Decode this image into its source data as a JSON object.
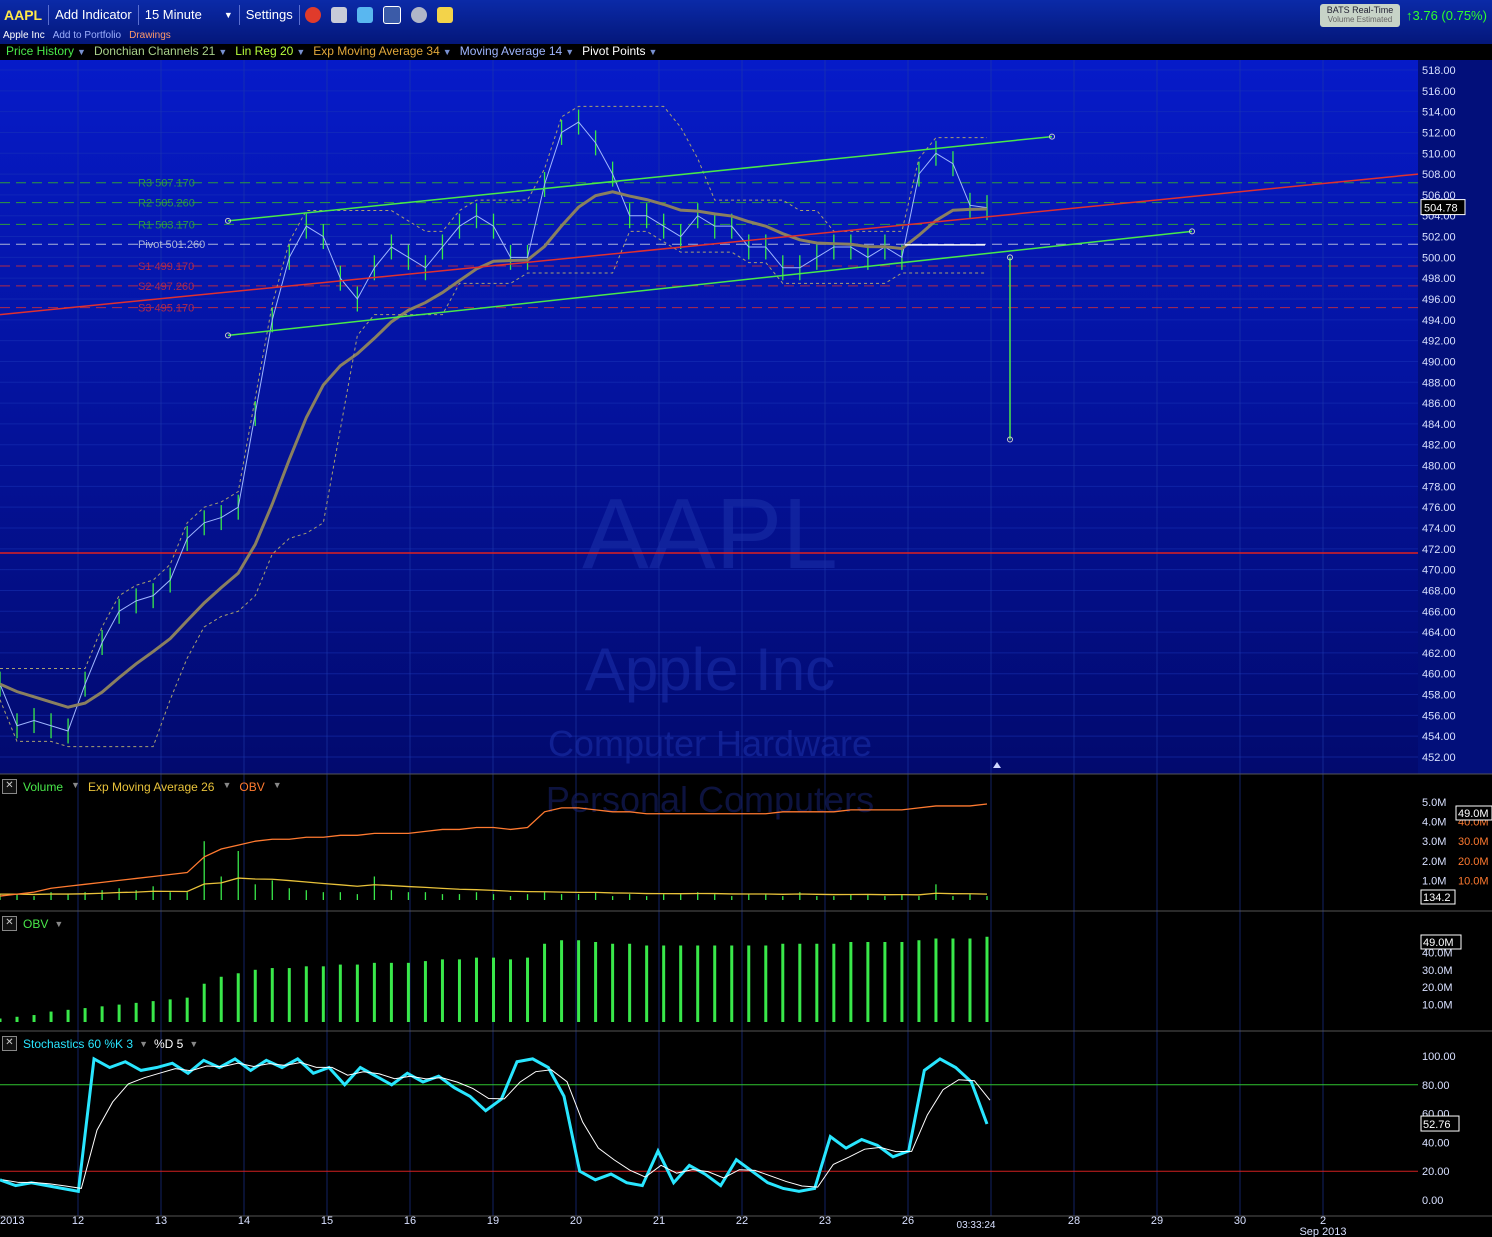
{
  "toolbar": {
    "symbol": "AAPL",
    "add_indicator": "Add Indicator",
    "interval": "15 Minute",
    "settings": "Settings",
    "company_name": "Apple Inc",
    "add_to_portfolio": "Add to Portfolio",
    "drawings": "Drawings",
    "realtime_title": "BATS Real-Time",
    "realtime_sub": "Volume Estimated",
    "change": "3.76 (0.75%)"
  },
  "indicators": [
    {
      "label": "Price History",
      "color": "#49e84a"
    },
    {
      "label": "Donchian Channels 21",
      "color": "#a8d08a"
    },
    {
      "label": "Lin Reg 20",
      "color": "#b7ff3c"
    },
    {
      "label": "Exp Moving Average 34",
      "color": "#e0a73a"
    },
    {
      "label": "Moving Average 14",
      "color": "#9fb6ff"
    },
    {
      "label": "Pivot Points",
      "color": "#ffffff"
    }
  ],
  "watermark": {
    "symbol": "AAPL",
    "company": "Apple Inc",
    "sector": "Computer Hardware",
    "industry": "Personal Computers"
  },
  "pivots": [
    {
      "label": "R3 507.170",
      "value": 507.17,
      "color": "#2f9b3e"
    },
    {
      "label": "R2 505.260",
      "value": 505.26,
      "color": "#2f9b3e"
    },
    {
      "label": "R1 503.170",
      "value": 503.17,
      "color": "#2f9b3e"
    },
    {
      "label": "Pivot 501.260",
      "value": 501.26,
      "color": "#aab4d8"
    },
    {
      "label": "S1 499.170",
      "value": 499.17,
      "color": "#b02a4a"
    },
    {
      "label": "S2 497.260",
      "value": 497.26,
      "color": "#b02a4a"
    },
    {
      "label": "S3 495.170",
      "value": 495.17,
      "color": "#b02a4a"
    }
  ],
  "price_ticks": [
    "518.00",
    "516.00",
    "514.00",
    "512.00",
    "510.00",
    "508.00",
    "506.00",
    "504.00",
    "502.00",
    "500.00",
    "498.00",
    "496.00",
    "494.00",
    "492.00",
    "490.00",
    "488.00",
    "486.00",
    "484.00",
    "482.00",
    "480.00",
    "478.00",
    "476.00",
    "474.00",
    "472.00",
    "470.00",
    "468.00",
    "466.00",
    "464.00",
    "462.00",
    "460.00",
    "458.00",
    "456.00",
    "454.00",
    "452.00"
  ],
  "last_price": "504.78",
  "volume_panel": {
    "labels": [
      {
        "label": "Volume",
        "color": "#49e84a"
      },
      {
        "label": "Exp Moving Average 26",
        "color": "#e8c23a"
      },
      {
        "label": "OBV",
        "color": "#ff7a30"
      }
    ],
    "ticks_left": [
      "5.0M",
      "4.0M",
      "3.0M",
      "2.0M",
      "1.0M"
    ],
    "ticks_right": [
      "40.0M",
      "30.0M",
      "20.0M",
      "10.0M"
    ],
    "obv_tag": "49.0M",
    "vol_tag": "134.2"
  },
  "obv_panel": {
    "label": "OBV",
    "ticks": [
      "40.0M",
      "30.0M",
      "20.0M",
      "10.0M"
    ],
    "tag": "49.0M"
  },
  "stoch_panel": {
    "label": "Stochastics 60 %K 3",
    "label2": "%D 5",
    "ticks": [
      "100.00",
      "80.00",
      "60.00",
      "40.00",
      "20.00",
      "0.00"
    ],
    "tag": "52.76"
  },
  "date_axis": [
    "2013",
    "12",
    "13",
    "14",
    "15",
    "16",
    "19",
    "20",
    "21",
    "22",
    "23",
    "26",
    "28",
    "29",
    "30",
    "2",
    "Sep 2013"
  ],
  "time_label": "03:33:24",
  "chart_data": {
    "type": "line",
    "title": "",
    "days": [
      "12",
      "13",
      "14",
      "15",
      "16",
      "19",
      "20",
      "21",
      "22",
      "23",
      "26"
    ],
    "ylim": [
      451,
      519
    ],
    "closes": [
      459,
      455,
      455.5,
      455,
      454.5,
      459,
      463,
      466,
      467,
      467.5,
      469,
      473,
      474.5,
      475,
      476,
      485,
      494,
      500,
      503,
      502,
      498,
      496,
      499,
      501,
      500,
      499,
      501,
      503,
      504,
      503,
      500,
      500,
      507,
      512,
      513,
      511,
      508,
      504,
      504,
      503,
      502,
      504,
      503,
      503,
      501,
      501,
      499,
      499,
      500,
      501,
      501,
      500,
      501,
      500,
      508,
      510,
      509,
      505,
      504.78
    ],
    "pivot_levels": [
      507.17,
      505.26,
      503.17,
      501.26,
      499.17,
      497.26,
      495.17
    ],
    "horizontal_line": 471.6,
    "volume_millions": [
      0.3,
      0.3,
      0.2,
      0.4,
      0.3,
      0.4,
      0.5,
      0.6,
      0.5,
      0.7,
      0.4,
      0.4,
      3.0,
      1.2,
      2.5,
      0.8,
      1.0,
      0.6,
      0.5,
      0.4,
      0.4,
      0.3,
      1.2,
      0.5,
      0.4,
      0.4,
      0.3,
      0.3,
      0.4,
      0.3,
      0.2,
      0.3,
      0.4,
      0.3,
      0.3,
      0.4,
      0.2,
      0.3,
      0.2,
      0.3,
      0.3,
      0.4,
      0.3,
      0.2,
      0.3,
      0.3,
      0.2,
      0.4,
      0.2,
      0.2,
      0.3,
      0.3,
      0.2,
      0.3,
      0.2,
      0.8,
      0.2,
      0.3,
      0.2
    ],
    "obv_millions": [
      2,
      3,
      4,
      6,
      7,
      8,
      9,
      10,
      11,
      12,
      13,
      14,
      22,
      26,
      28,
      30,
      31,
      31,
      32,
      32,
      33,
      33,
      34,
      34,
      34,
      35,
      36,
      36,
      37,
      37,
      36,
      37,
      45,
      47,
      47,
      46,
      45,
      45,
      44,
      44,
      44,
      44,
      44,
      44,
      44,
      44,
      45,
      45,
      45,
      45,
      46,
      46,
      46,
      46,
      47,
      48,
      48,
      48,
      49
    ],
    "stoch_k": [
      14,
      10,
      12,
      10,
      8,
      6,
      98,
      92,
      96,
      90,
      92,
      95,
      88,
      97,
      92,
      98,
      90,
      97,
      92,
      98,
      88,
      92,
      80,
      92,
      86,
      80,
      88,
      82,
      86,
      78,
      72,
      62,
      70,
      96,
      98,
      92,
      72,
      20,
      14,
      18,
      12,
      10,
      34,
      12,
      24,
      18,
      10,
      28,
      20,
      12,
      8,
      6,
      8,
      44,
      36,
      42,
      38,
      30,
      34,
      90,
      98,
      92,
      82,
      52.76
    ],
    "stoch_overbought": 80,
    "stoch_oversold": 20
  }
}
